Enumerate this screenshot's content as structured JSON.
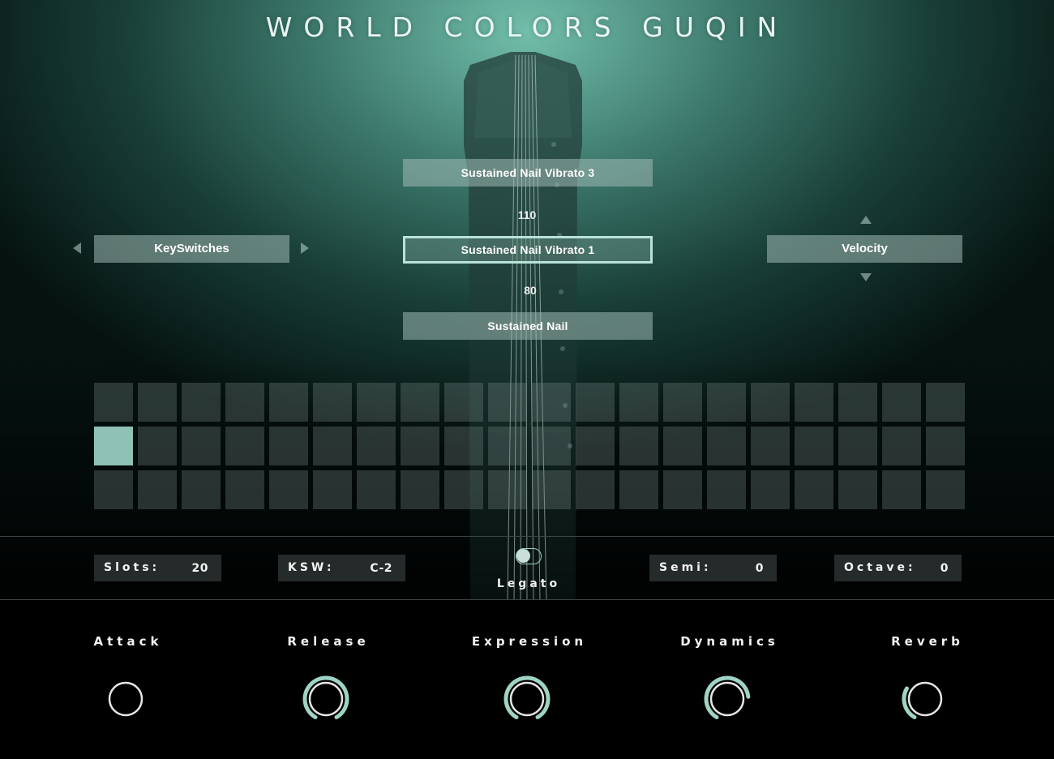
{
  "title": "WORLD COLORS GUQIN",
  "articulations": {
    "upper": "Sustained Nail Vibrato 3",
    "upper_value": "110",
    "selected": "Sustained Nail Vibrato 1",
    "lower_value": "80",
    "lower": "Sustained Nail"
  },
  "left_selector": {
    "label": "KeySwitches"
  },
  "right_selector": {
    "label": "Velocity"
  },
  "slots_grid": {
    "rows": 3,
    "columns": 20,
    "active_row": 1,
    "active_col": 0
  },
  "controls": {
    "slots": {
      "label": "Slots:",
      "value": "20"
    },
    "ksw": {
      "label": "KSW:",
      "value": "C-2"
    },
    "legato": {
      "label": "Legato",
      "enabled": false
    },
    "semi": {
      "label": "Semi:",
      "value": "0"
    },
    "octave": {
      "label": "Octave:",
      "value": "0"
    }
  },
  "knobs": [
    {
      "label": "Attack",
      "level": 0.0
    },
    {
      "label": "Release",
      "level": 1.0
    },
    {
      "label": "Expression",
      "level": 1.0
    },
    {
      "label": "Dynamics",
      "level": 0.78
    },
    {
      "label": "Reverb",
      "level": 0.3
    }
  ],
  "colors": {
    "accent": "#9fd3c6",
    "active_slot": "#8fc1b5",
    "field_bg": "#252b2a"
  }
}
